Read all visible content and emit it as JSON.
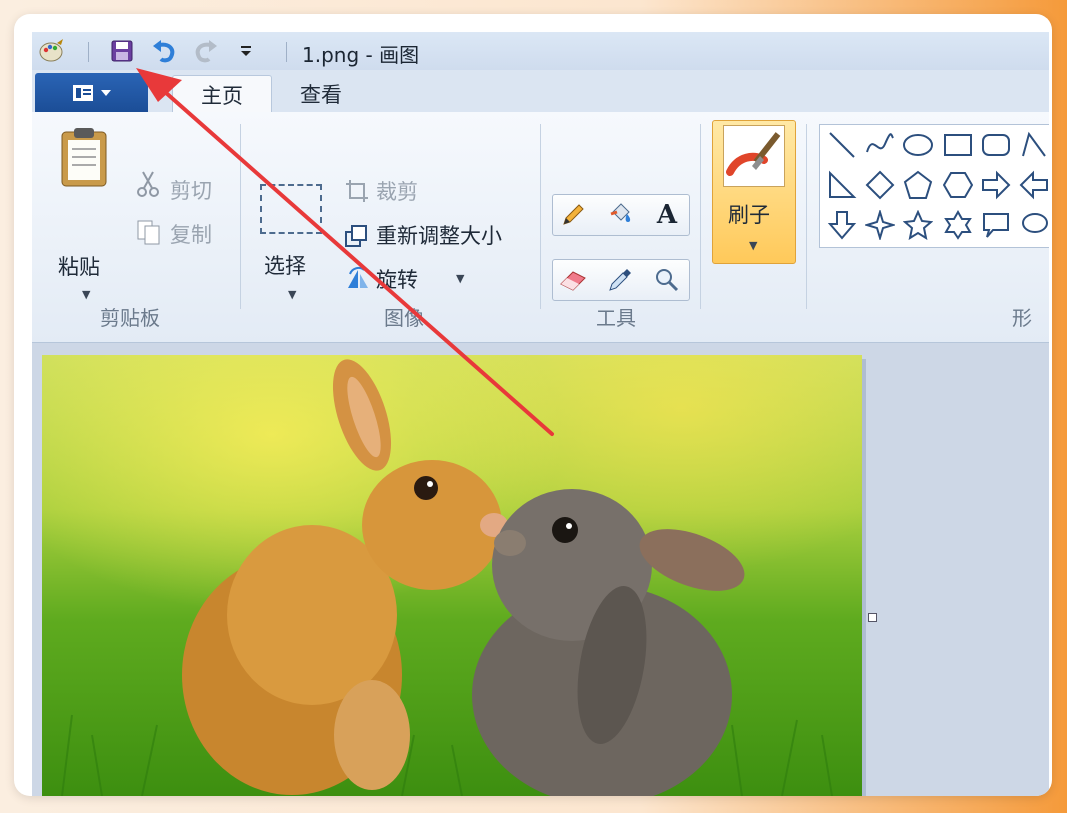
{
  "window": {
    "title": "1.png - 画图"
  },
  "tabs": [
    {
      "label": "主页",
      "active": true
    },
    {
      "label": "查看",
      "active": false
    }
  ],
  "ribbon": {
    "clipboard": {
      "paste": "粘贴",
      "cut": "剪切",
      "copy": "复制",
      "group": "剪贴板"
    },
    "image": {
      "select": "选择",
      "crop": "裁剪",
      "resize": "重新调整大小",
      "rotate": "旋转",
      "group": "图像"
    },
    "tools": {
      "group": "工具"
    },
    "brushes": {
      "label": "刷子"
    },
    "shapes": {
      "group": "形"
    }
  },
  "colors": {
    "file_button": "#1b4d96",
    "annotation_arrow": "#e8393a",
    "brush_highlight": "#ffc95a"
  }
}
